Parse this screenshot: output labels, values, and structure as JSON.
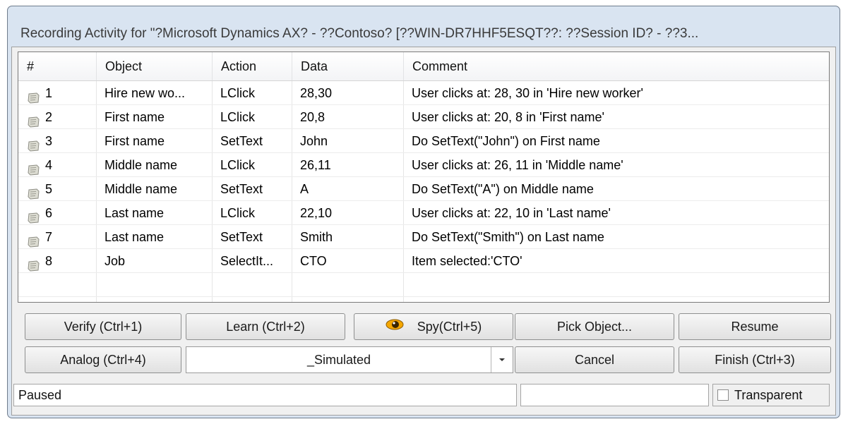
{
  "window": {
    "title": "Recording Activity for \"?Microsoft Dynamics AX? - ??Contoso? [??WIN-DR7HHF5ESQT??: ??Session ID? - ??3..."
  },
  "grid": {
    "columns": [
      "#",
      "Object",
      "Action",
      "Data",
      "Comment"
    ],
    "rows": [
      {
        "num": "1",
        "object": "Hire new wo...",
        "action": "LClick",
        "data": "28,30",
        "comment": "User clicks at: 28, 30 in 'Hire new worker'"
      },
      {
        "num": "2",
        "object": "First name",
        "action": "LClick",
        "data": "20,8",
        "comment": "User clicks at: 20, 8 in 'First name'"
      },
      {
        "num": "3",
        "object": "First name",
        "action": "SetText",
        "data": "John",
        "comment": "Do SetText(\"John\") on First name"
      },
      {
        "num": "4",
        "object": "Middle name",
        "action": "LClick",
        "data": "26,11",
        "comment": "User clicks at: 26, 11 in 'Middle name'"
      },
      {
        "num": "5",
        "object": "Middle name",
        "action": "SetText",
        "data": "A",
        "comment": "Do SetText(\"A\") on Middle name"
      },
      {
        "num": "6",
        "object": "Last name",
        "action": "LClick",
        "data": "22,10",
        "comment": "User clicks at: 22, 10 in 'Last name'"
      },
      {
        "num": "7",
        "object": "Last name",
        "action": "SetText",
        "data": "Smith",
        "comment": "Do SetText(\"Smith\") on Last name"
      },
      {
        "num": "8",
        "object": "Job",
        "action": "SelectIt...",
        "data": "CTO",
        "comment": "Item selected:'CTO'"
      }
    ],
    "row_icon": "script-page-icon"
  },
  "buttons": {
    "verify": "Verify (Ctrl+1)",
    "learn": "Learn (Ctrl+2)",
    "spy": "Spy(Ctrl+5)",
    "spy_icon": "eye-icon",
    "pick_object": "Pick Object...",
    "resume": "Resume",
    "analog": "Analog (Ctrl+4)",
    "mode_value": "_Simulated",
    "cancel": "Cancel",
    "finish": "Finish (Ctrl+3)"
  },
  "status": {
    "text": "Paused",
    "secondary": "",
    "transparent_label": "Transparent",
    "transparent_checked": false
  }
}
